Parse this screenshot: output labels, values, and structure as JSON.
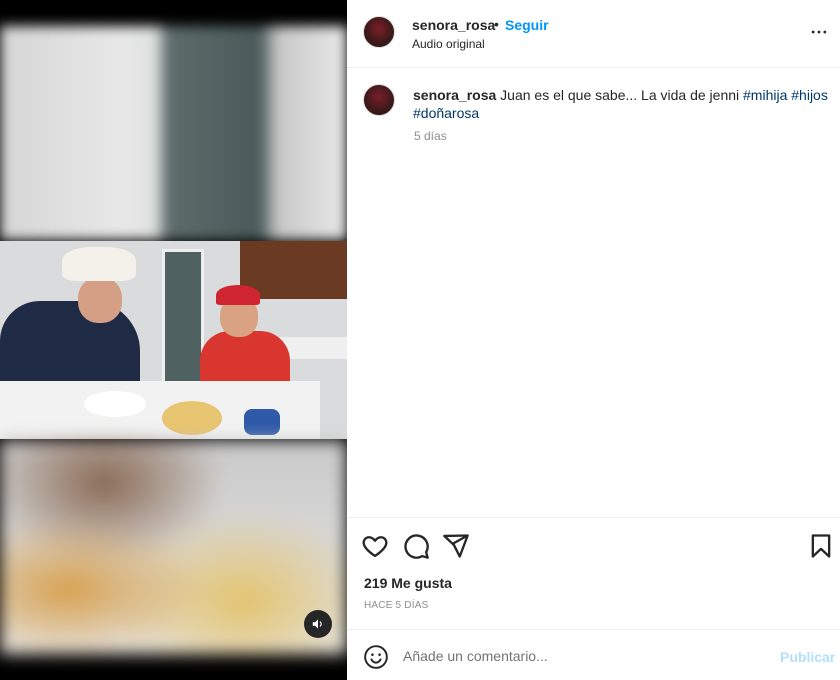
{
  "post": {
    "username": "senora_rosa",
    "separator": "•",
    "follow_label": "Seguir",
    "audio_label": "Audio original"
  },
  "caption": {
    "username": "senora_rosa",
    "text": "Juan es el que sabe... La vida de jenni",
    "hashtags": [
      "#mihija",
      "#hijos",
      "#doñarosa"
    ],
    "age": "5 días"
  },
  "stats": {
    "likes": "219 Me gusta",
    "timestamp": "HACE 5 DÍAS"
  },
  "comment": {
    "placeholder": "Añade un comentario...",
    "publish_label": "Publicar"
  },
  "icons": {
    "more": "more-options-icon",
    "like": "heart-icon",
    "comment": "comment-icon",
    "share": "share-icon",
    "save": "bookmark-icon",
    "emoji": "emoji-icon",
    "sound": "speaker-icon"
  },
  "colors": {
    "accent": "#0095f6",
    "hashtag": "#00376b",
    "publish_disabled": "#b2dffc",
    "muted": "#8e8e8e"
  }
}
